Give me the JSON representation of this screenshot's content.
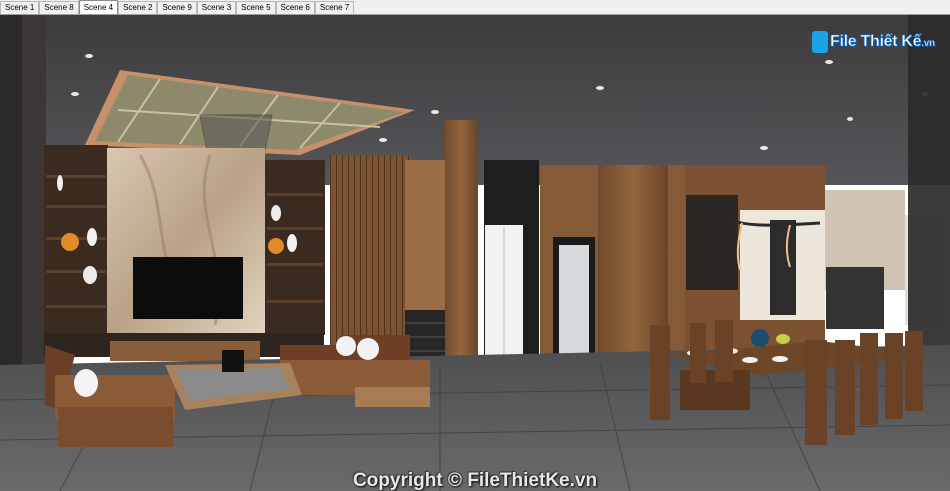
{
  "tabs": [
    {
      "label": "Scene 1",
      "active": false
    },
    {
      "label": "Scene 8",
      "active": false
    },
    {
      "label": "Scene 4",
      "active": true
    },
    {
      "label": "Scene 2",
      "active": false
    },
    {
      "label": "Scene 9",
      "active": false
    },
    {
      "label": "Scene 3",
      "active": false
    },
    {
      "label": "Scene 5",
      "active": false
    },
    {
      "label": "Scene 6",
      "active": false
    },
    {
      "label": "Scene 7",
      "active": false
    }
  ],
  "watermark": {
    "logo_text": "File Thiết Kế",
    "logo_domain": ".vn",
    "copyright": "Copyright © FileThietKe.vn"
  },
  "colors": {
    "ceiling": "#4a4a4c",
    "floor": "#5a5a5c",
    "wood": "#8a5e3a",
    "logo_blue": "#1aa3e8"
  }
}
